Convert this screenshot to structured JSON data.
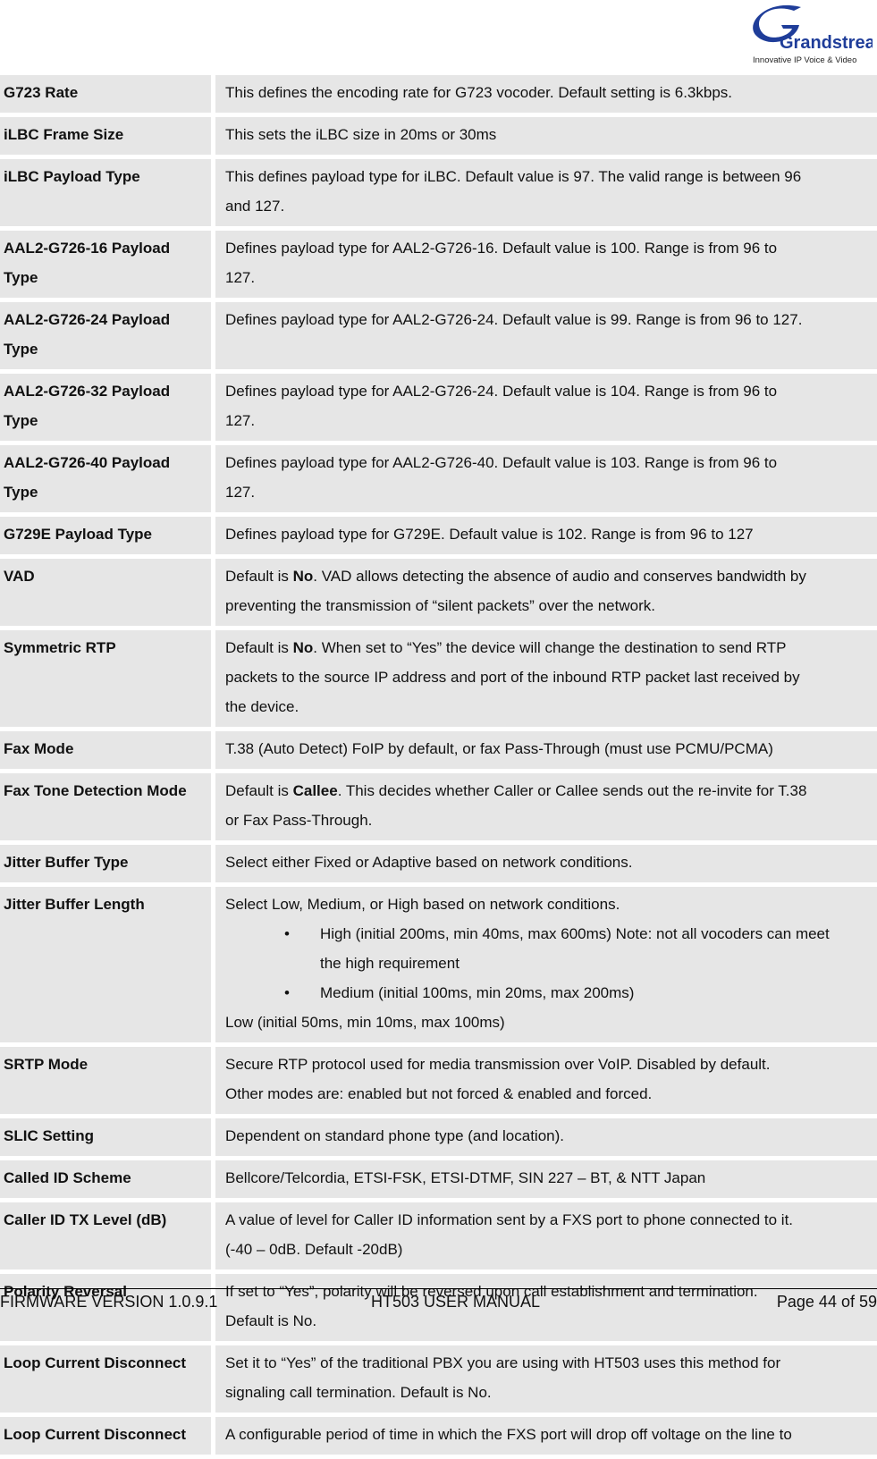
{
  "header": {
    "logo": {
      "brand": "Grandstream",
      "tagline": "Innovative IP Voice & Video",
      "color": "#1f3d99"
    }
  },
  "rows": [
    {
      "name": "G723 Rate",
      "desc": [
        "This defines the encoding rate for G723 vocoder. Default setting is 6.3kbps."
      ]
    },
    {
      "name": "iLBC Frame Size",
      "desc": [
        "This sets the iLBC size in 20ms or 30ms"
      ]
    },
    {
      "name": "iLBC Payload Type",
      "desc": [
        "This defines payload type for iLBC. Default value is 97. The valid range is between 96",
        "and 127."
      ]
    },
    {
      "name": "AAL2-G726-16 Payload Type",
      "desc": [
        "Defines payload type for AAL2-G726-16.  Default value is 100.  Range is from 96 to",
        "127."
      ]
    },
    {
      "name": "AAL2-G726-24 Payload Type",
      "desc": [
        "Defines payload type for AAL2-G726-24.  Default value is 99.  Range is from 96 to 127."
      ]
    },
    {
      "name": "AAL2-G726-32 Payload Type",
      "desc": [
        "Defines payload type for AAL2-G726-24. Default value is 104.  Range is from 96 to",
        "127."
      ]
    },
    {
      "name": "AAL2-G726-40 Payload Type",
      "desc": [
        "Defines payload type for AAL2-G726-40.  Default value is 103.  Range is from 96 to",
        "127."
      ]
    },
    {
      "name": "G729E Payload Type",
      "desc": [
        "Defines payload type for G729E.  Default value is 102.  Range is from 96 to 127"
      ]
    },
    {
      "name": "VAD",
      "desc_prefix": "Default is ",
      "desc_bold": "No",
      "desc": [
        ".  VAD allows detecting the absence of audio and conserves bandwidth by",
        "preventing the transmission of “silent packets” over the network."
      ]
    },
    {
      "name": "Symmetric RTP",
      "desc_prefix": "Default is ",
      "desc_bold": "No",
      "desc": [
        ".  When set to “Yes” the device will change the destination to send RTP",
        "packets to the source IP address and port of the inbound RTP packet last received by",
        "the device."
      ]
    },
    {
      "name": "Fax Mode",
      "desc": [
        "T.38 (Auto Detect) FoIP by default, or fax Pass-Through (must use PCMU/PCMA)"
      ]
    },
    {
      "name": "Fax Tone Detection Mode",
      "desc_prefix": "Default is ",
      "desc_bold": "Callee",
      "desc": [
        ".  This decides whether Caller or Callee sends out the re-invite for T.38",
        "or Fax Pass-Through."
      ]
    },
    {
      "name": "Jitter Buffer Type",
      "desc": [
        "Select either Fixed or Adaptive based on network conditions."
      ]
    },
    {
      "name": "Jitter Buffer Length",
      "desc": [
        "Select Low, Medium, or High based on network conditions."
      ],
      "bullets": [
        {
          "symbol": "•",
          "lines": [
            "High (initial 200ms, min 40ms, max 600ms) Note: not all vocoders can meet",
            "the high requirement"
          ]
        },
        {
          "symbol": "•",
          "lines": [
            "Medium (initial 100ms, min 20ms, max 200ms)"
          ]
        }
      ],
      "desc_after": [
        "Low (initial 50ms, min 10ms, max 100ms)"
      ]
    },
    {
      "name": "SRTP Mode",
      "desc": [
        "Secure RTP protocol used for media transmission over VoIP.  Disabled by default.",
        "Other modes are: enabled but not forced & enabled and forced."
      ]
    },
    {
      "name": "SLIC Setting",
      "desc": [
        "Dependent on standard phone type (and location)."
      ]
    },
    {
      "name": "Called ID Scheme",
      "desc": [
        " Bellcore/Telcordia, ETSI-FSK, ETSI-DTMF, SIN 227 – BT, & NTT Japan"
      ]
    },
    {
      "name": "Caller ID TX Level (dB)",
      "desc": [
        "A value of level for Caller ID information sent by a FXS port  to phone connected to it.",
        "(-40 – 0dB.  Default -20dB)"
      ]
    },
    {
      "name": "Polarity Reversal",
      "desc": [
        "If set to “Yes”, polarity will be reversed upon call establishment and termination.",
        "Default is No."
      ]
    },
    {
      "name": "Loop Current Disconnect",
      "desc": [
        "Set it to “Yes” of the traditional PBX you are using with HT503 uses this method for",
        "signaling call termination.  Default is No."
      ]
    },
    {
      "name": "Loop Current Disconnect",
      "desc": [
        "A configurable period of time in which the FXS port will drop off voltage on the line to"
      ]
    }
  ],
  "footer": {
    "firmware": "FIRMWARE VERSION 1.0.9.1",
    "manual": "HT503 USER MANUAL",
    "page": "Page 44 of 59"
  }
}
